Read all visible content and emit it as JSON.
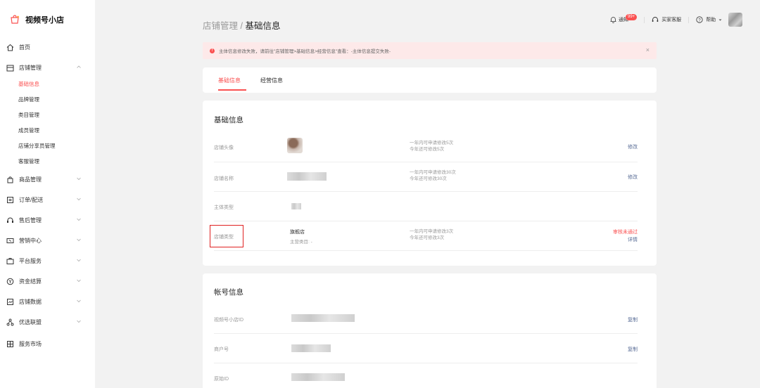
{
  "app": {
    "name": "视频号小店"
  },
  "sidebar": {
    "items": [
      {
        "label": "首页",
        "icon": "home-icon"
      },
      {
        "label": "店铺管理",
        "icon": "shop-icon",
        "expanded": true
      },
      {
        "label": "商品管理",
        "icon": "bag-icon"
      },
      {
        "label": "订单/配送",
        "icon": "order-icon"
      },
      {
        "label": "售后管理",
        "icon": "headset-icon"
      },
      {
        "label": "营销中心",
        "icon": "coupon-icon"
      },
      {
        "label": "平台服务",
        "icon": "briefcase-icon"
      },
      {
        "label": "资金结算",
        "icon": "money-icon"
      },
      {
        "label": "店铺数据",
        "icon": "chart-icon"
      },
      {
        "label": "优选联盟",
        "icon": "network-icon"
      },
      {
        "label": "服务市场",
        "icon": "grid-icon"
      }
    ],
    "shop_subitems": [
      "基础信息",
      "品牌管理",
      "类目管理",
      "成员管理",
      "店铺分享员管理",
      "客服管理"
    ]
  },
  "header": {
    "breadcrumb_parent": "店铺管理",
    "breadcrumb_sep": " / ",
    "breadcrumb_current": "基础信息",
    "notify_label": "通知",
    "notify_badge": "99+",
    "service_label": "买家客服",
    "help_label": "帮助"
  },
  "alert": {
    "text": "主体信息修改失败，请前往\"店铺管理>基础信息>经营信息\"查看：-主体信息提交失败-",
    "close": "×"
  },
  "tabs": [
    "基础信息",
    "经营信息"
  ],
  "basic": {
    "title": "基础信息",
    "rows": [
      {
        "label": "店铺头像",
        "note1": "一年内可申请修改5次",
        "note2": "今年还可修改5次",
        "action": "修改"
      },
      {
        "label": "店铺名称",
        "note1": "一年内可申请修改30次",
        "note2": "今年还可修改30次",
        "action": "修改"
      },
      {
        "label": "主体类型"
      },
      {
        "label": "店铺类型",
        "value": "旗舰店",
        "sub": "主营类目: -",
        "note1": "一年内可申请修改3次",
        "note2": "今年还可修改3次",
        "action": "审核未通过",
        "action2": "详情"
      }
    ]
  },
  "account": {
    "title": "帐号信息",
    "rows": [
      {
        "label": "视频号小店ID",
        "action": "复制"
      },
      {
        "label": "商户号",
        "action": "复制"
      },
      {
        "label": "原始ID"
      }
    ]
  },
  "colors": {
    "accent": "#fa5151",
    "link": "#576b95",
    "background": "#f2f2f2"
  }
}
